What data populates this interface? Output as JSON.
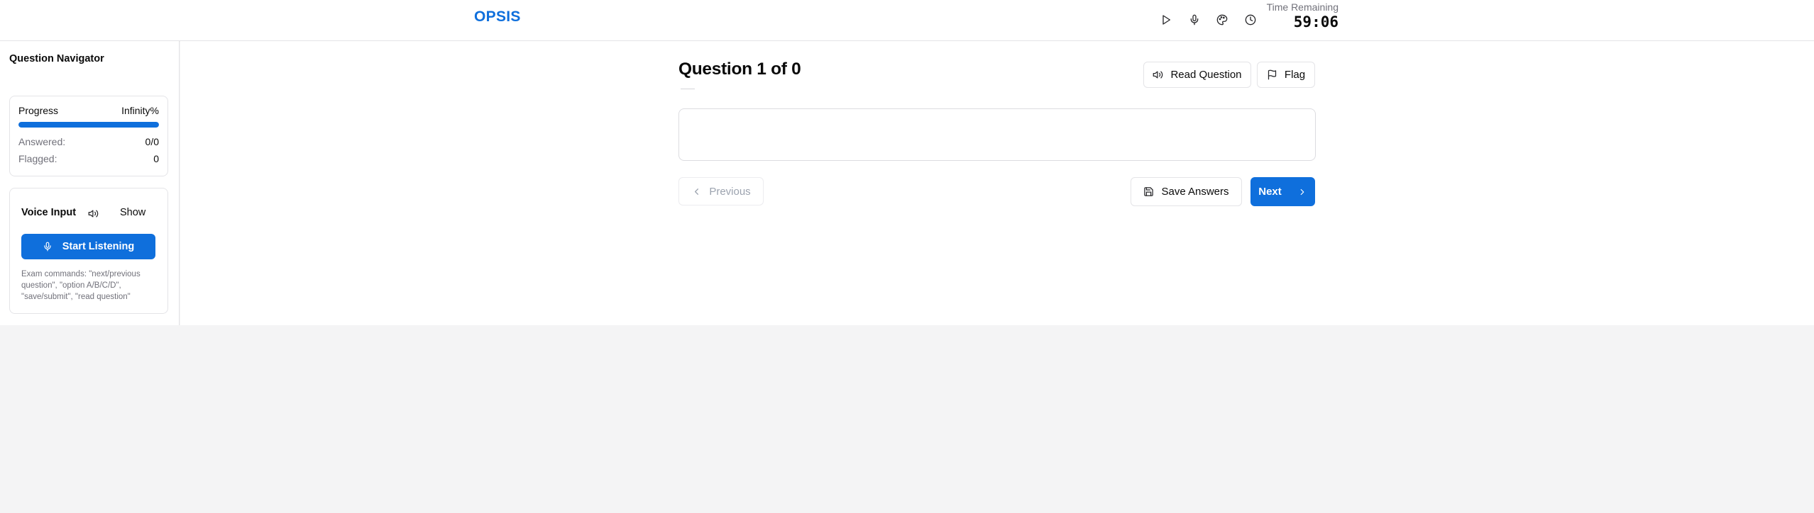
{
  "header": {
    "logo": "OPSIS",
    "icons": [
      "play-icon",
      "microphone-icon",
      "palette-icon",
      "clock-icon"
    ],
    "timer_label": "Time Remaining",
    "timer_value": "59:06"
  },
  "sidebar": {
    "title": "Question Navigator",
    "progress": {
      "label": "Progress",
      "percent_text": "Infinity%",
      "fill_fraction": 1.0,
      "answered_label": "Answered:",
      "answered_value": "0/0",
      "flagged_label": "Flagged:",
      "flagged_value": "0"
    },
    "voice": {
      "title": "Voice Input",
      "show_label": "Show",
      "listen_label": "Start Listening",
      "help_text": "Exam commands: \"next/previous question\", \"option A/B/C/D\", \"save/submit\", \"read question\""
    }
  },
  "main": {
    "question_title": "Question 1 of 0",
    "read_question_label": "Read Question",
    "flag_label": "Flag",
    "previous_label": "Previous",
    "save_label": "Save Answers",
    "next_label": "Next"
  },
  "colors": {
    "accent": "#0f6fdc",
    "border": "#e4e4e7",
    "muted_text": "#71717a",
    "page_bg": "#f4f4f5"
  }
}
